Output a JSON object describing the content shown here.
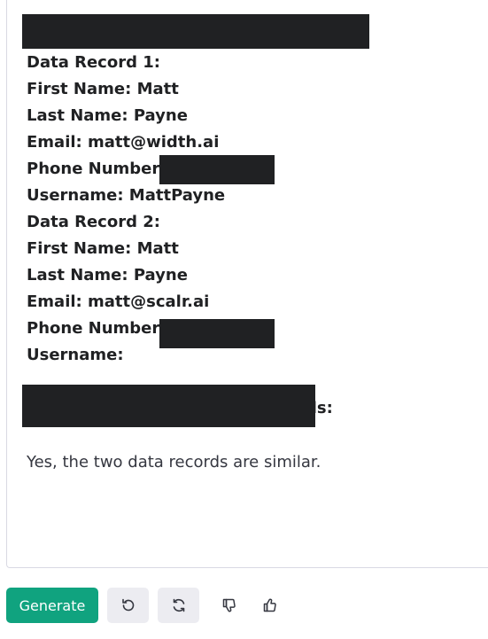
{
  "record1": {
    "heading": "Data Record 1:",
    "first_name": "First Name: Matt",
    "last_name": "Last Name: Payne",
    "email": "Email: matt@width.ai",
    "phone_label": "Phone Number:",
    "username": "Username: MattPayne"
  },
  "record2": {
    "heading": "Data Record 2:",
    "first_name": "First Name: Matt",
    "last_name": "Last Name: Payne",
    "email": "Email: matt@scalr.ai",
    "phone_label": "Phone Number:",
    "username": "Username:"
  },
  "prompt_tail": "ds:",
  "answer": "Yes, the two data records are similar.",
  "toolbar": {
    "generate_label": "Generate",
    "undo_icon": "undo-icon",
    "regenerate_icon": "refresh-icon",
    "thumbs_down_icon": "thumbs-down-icon",
    "thumbs_up_icon": "thumbs-up-icon"
  },
  "colors": {
    "accent": "#10a37f",
    "redaction": "#202123",
    "text": "#202123"
  }
}
